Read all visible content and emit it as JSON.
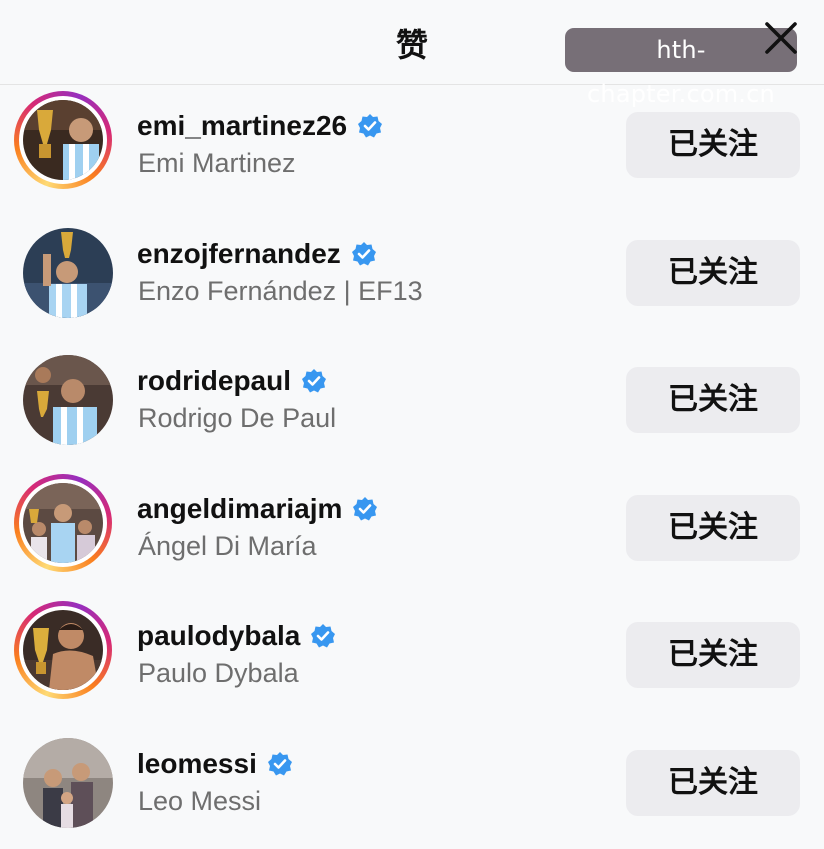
{
  "header": {
    "title": "赞"
  },
  "watermark": {
    "text": "hth-chapter.com.cn"
  },
  "users": [
    {
      "username": "emi_martinez26",
      "full_name": "Emi Martinez",
      "verified": true,
      "story_ring": true,
      "button": "已关注"
    },
    {
      "username": "enzojfernandez",
      "full_name": "Enzo Fernández | EF13",
      "verified": true,
      "story_ring": false,
      "button": "已关注"
    },
    {
      "username": "rodridepaul",
      "full_name": "Rodrigo De Paul",
      "verified": true,
      "story_ring": false,
      "button": "已关注"
    },
    {
      "username": "angeldimariajm",
      "full_name": "Ángel Di María",
      "verified": true,
      "story_ring": true,
      "button": "已关注"
    },
    {
      "username": "paulodybala",
      "full_name": "Paulo Dybala",
      "verified": true,
      "story_ring": true,
      "button": "已关注"
    },
    {
      "username": "leomessi",
      "full_name": "Leo Messi",
      "verified": true,
      "story_ring": false,
      "button": "已关注"
    }
  ],
  "colors": {
    "verified": "#3897f0",
    "button_bg": "#ececef",
    "secondary_text": "#6e6e6e"
  },
  "icons": {
    "close": "close-icon",
    "verified": "verified-badge-icon"
  }
}
